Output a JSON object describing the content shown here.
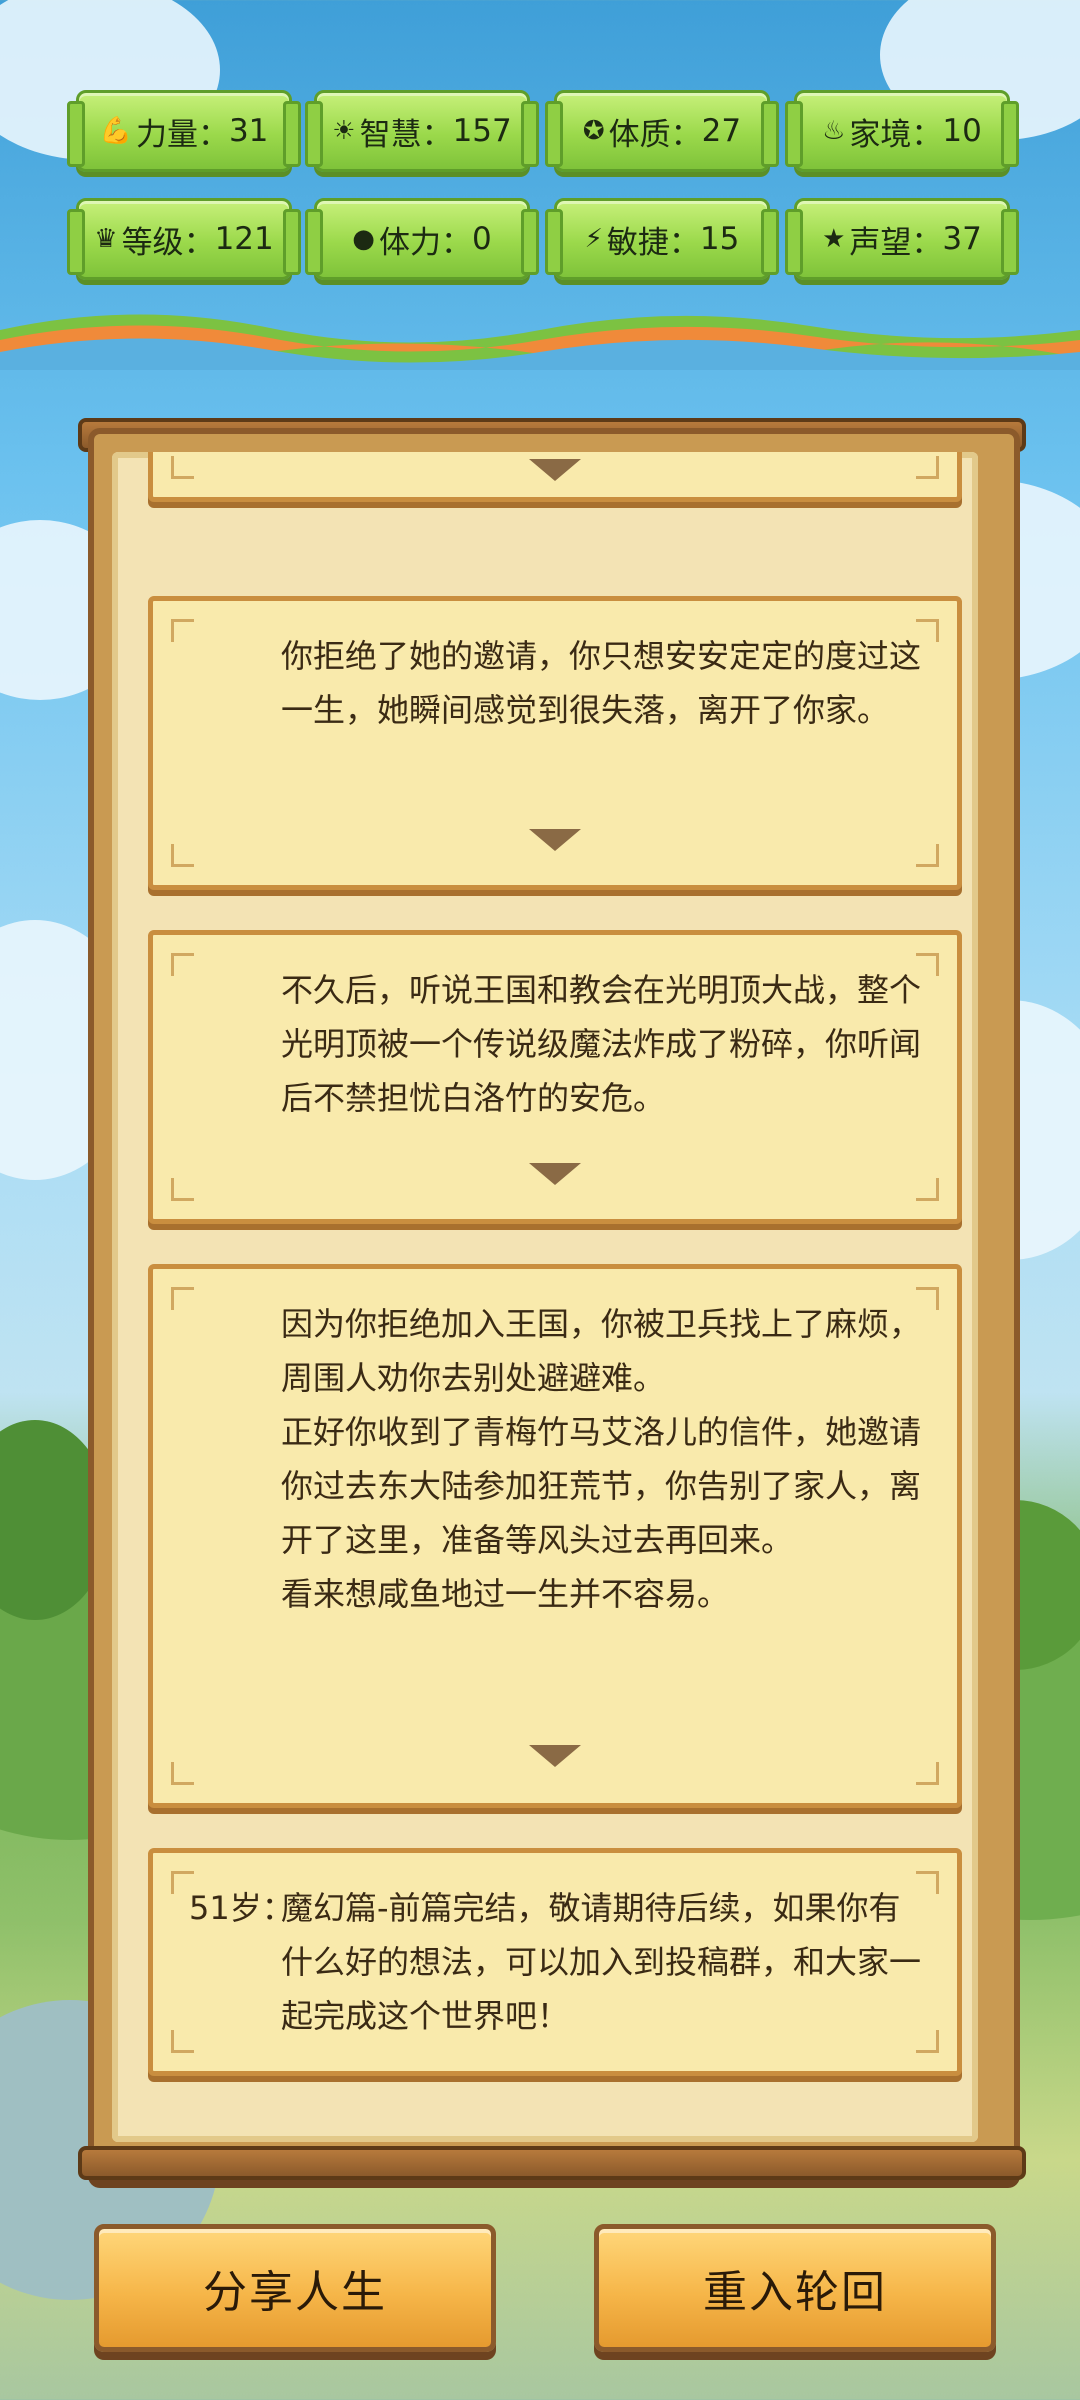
{
  "stats": [
    {
      "icon": "💪",
      "label": "力量",
      "value": "31"
    },
    {
      "icon": "☀",
      "label": "智慧",
      "value": "157"
    },
    {
      "icon": "✪",
      "label": "体质",
      "value": "27"
    },
    {
      "icon": "♨",
      "label": "家境",
      "value": "10"
    },
    {
      "icon": "♛",
      "label": "等级",
      "value": "121"
    },
    {
      "icon": "●",
      "label": "体力",
      "value": " 0"
    },
    {
      "icon": "⚡",
      "label": "敏捷",
      "value": "15"
    },
    {
      "icon": "★",
      "label": "声望",
      "value": "37"
    }
  ],
  "events": [
    {
      "age": "",
      "text": "你拒绝了她的邀请，你只想安安定定的度过这一生，她瞬间感觉到很失落，离开了你家。"
    },
    {
      "age": "",
      "text": "不久后，听说王国和教会在光明顶大战，整个光明顶被一个传说级魔法炸成了粉碎，你听闻后不禁担忧白洛竹的安危。"
    },
    {
      "age": "",
      "text": "因为你拒绝加入王国，你被卫兵找上了麻烦，周围人劝你去别处避避难。\n正好你收到了青梅竹马艾洛儿的信件，她邀请你过去东大陆参加狂荒节，你告别了家人，离开了这里，准备等风头过去再回来。\n看来想咸鱼地过一生并不容易。"
    },
    {
      "age": "51岁：",
      "text": "魔幻篇-前篇完结，敬请期待后续，如果你有什么好的想法，可以加入到投稿群，和大家一起完成这个世界吧！"
    }
  ],
  "buttons": {
    "share": "分享人生",
    "restart": "重入轮回"
  }
}
